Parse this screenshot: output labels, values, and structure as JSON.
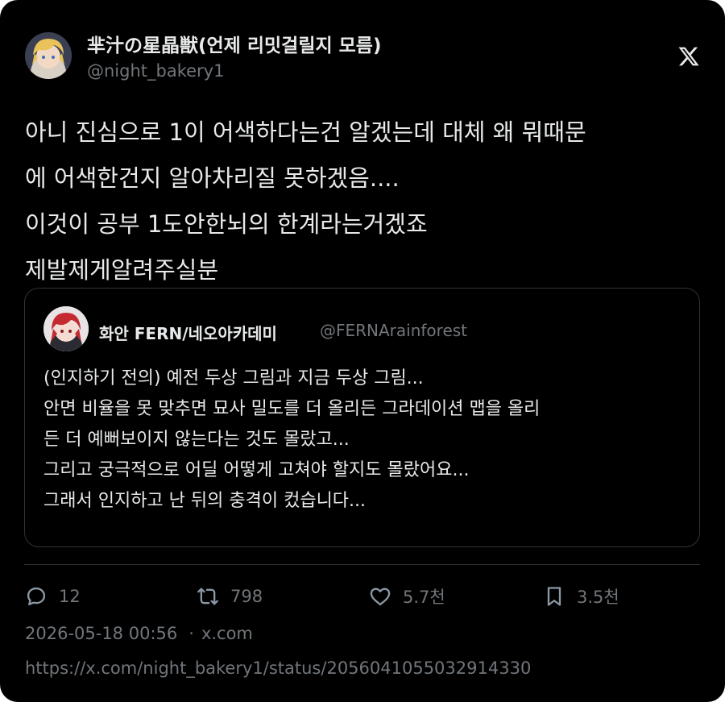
{
  "author": {
    "display_name": "芈汁の星晶獣(언제 리밋걸릴지 모름)",
    "handle": "@night_bakery1",
    "avatar_icon": "anime-avatar-blond"
  },
  "platform_logo": "x-logo",
  "post": {
    "lines": [
      "아니 진심으로 1이 어색하다는건 알겠는데 대체 왜 뭐때문",
      "에 어색한건지 알아차리질 못하겠음....",
      "이것이 공부 1도안한뇌의 한계라는거겠죠",
      "제발제게알려주실분"
    ]
  },
  "quote": {
    "display_name": "화안 FERN/네오아카데미",
    "handle": "@FERNArainforest",
    "avatar_icon": "anime-avatar-red",
    "lines": [
      "(인지하기 전의) 예전 두상 그림과 지금 두상 그림...",
      "안면 비율을 못 맞추면 묘사 밀도를 더 올리든 그라데이션 맵을 올리",
      "든 더 예뻐보이지 않는다는 것도 몰랐고...",
      "그리고 궁극적으로 어딜 어떻게 고쳐야 할지도 몰랐어요...",
      "그래서 인지하고 난 뒤의 충격이 컸습니다..."
    ]
  },
  "actions": {
    "replies": "12",
    "reposts": "798",
    "likes": "5.7천",
    "bookmarks": "3.5천"
  },
  "meta": {
    "timestamp": "2026-05-18 00:56",
    "source": "x.com",
    "url": "https://x.com/night_bakery1/status/2056041055032914330"
  },
  "colors": {
    "background": "#000000",
    "text_primary": "#e7e9ea",
    "text_secondary": "#71767b",
    "border": "#2f3336"
  }
}
